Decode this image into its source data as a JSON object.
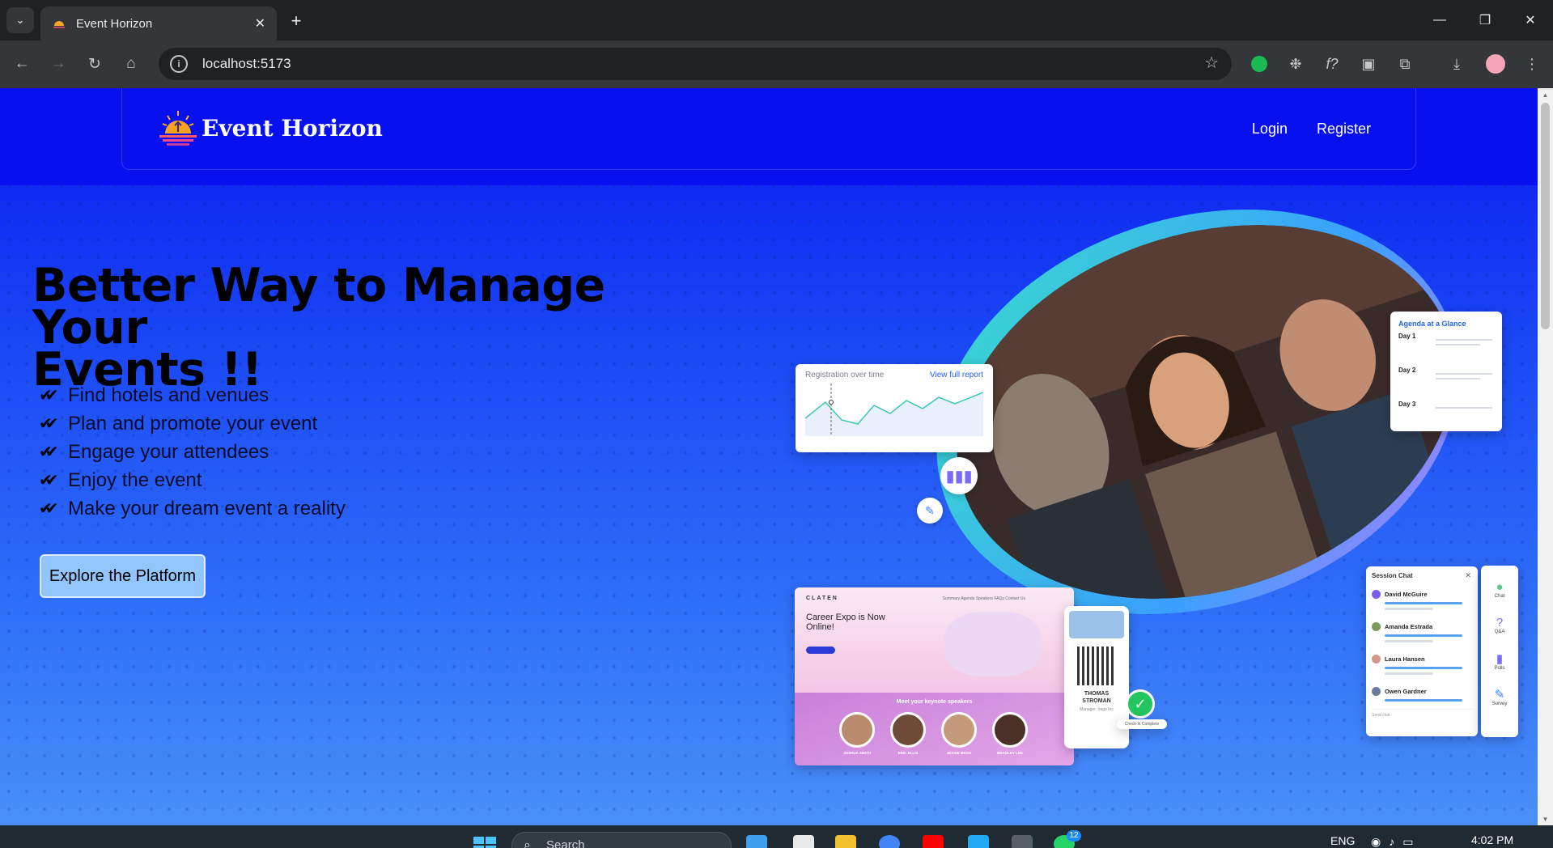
{
  "browser": {
    "tab_title": "Event Horizon",
    "url": "localhost:5173"
  },
  "nav": {
    "brand": "Event Horizon",
    "login": "Login",
    "register": "Register"
  },
  "hero": {
    "title_line1": "Better Way to Manage Your",
    "title_line2": "Events !!",
    "features": [
      "Find hotels and venues",
      "Plan and promote your event",
      "Engage your attendees",
      "Enjoy the event",
      "Make your dream event a reality"
    ],
    "cta": "Explore the Platform"
  },
  "illustration": {
    "registration_title": "Registration over time",
    "registration_link": "View full report",
    "agenda_title": "Agenda at a Glance",
    "agenda_days": [
      "Day 1",
      "Day 2",
      "Day 3"
    ],
    "site_logo": "CLATEN",
    "site_nav": "Summary   Agenda   Speakers   FAQs   Contact Us",
    "site_headline_1": "Career Expo is Now",
    "site_headline_2": "Online!",
    "speakers_title": "Meet your keynote speakers",
    "speakers": [
      "JOSHUA SMITH",
      "ERIC ELLIS",
      "JESSIE MOSS",
      "BRADLEY LEE"
    ],
    "badge_name_1": "THOMAS",
    "badge_name_2": "STROMAN",
    "badge_role": "Manager, Irago Inc",
    "checkin_label": "Check-in Complete",
    "chat_title": "Session Chat",
    "chat_people": [
      "David McGuire",
      "Amanda Estrada",
      "Laura Hansen",
      "Owen Gardner"
    ],
    "chat_placeholder": "Send chat",
    "side_items": [
      "Chat",
      "Q&A",
      "Polls",
      "Survey"
    ]
  },
  "taskbar": {
    "search_placeholder": "Search",
    "badge_count": "12",
    "language": "ENG",
    "time": "4:02 PM"
  },
  "colors": {
    "header_blue": "#0810f0",
    "button_fill": "#93c5fd",
    "accent_blue": "#2563eb"
  }
}
